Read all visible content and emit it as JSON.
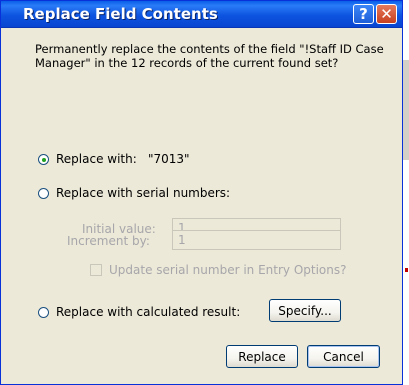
{
  "dialog": {
    "title": "Replace Field Contents",
    "help_glyph": "?",
    "close_glyph": "✕",
    "description": "Permanently replace the contents of the field \"!Staff ID Case Manager\" in the 12 records of the current found set?",
    "option_replace_with": {
      "label": "Replace with:",
      "value": "\"7013\"",
      "selected": true
    },
    "option_serial": {
      "label": "Replace with serial numbers:",
      "selected": false,
      "initial_value_label": "Initial value:",
      "initial_value": "1",
      "increment_label": "Increment by:",
      "increment_value": "1",
      "update_entry_options_label": "Update serial number in Entry Options?",
      "update_entry_options_checked": false
    },
    "option_calculated": {
      "label": "Replace with calculated result:",
      "selected": false,
      "specify_button": "Specify..."
    },
    "replace_button": "Replace",
    "cancel_button": "Cancel"
  },
  "colors": {
    "titlebar": "#0a5fe8",
    "dialog_bg": "#ece9d8",
    "disabled_text": "#a7a6aa",
    "radio_dot": "#21a121"
  },
  "icons": {
    "help": "question-mark-icon",
    "close": "close-x-icon"
  }
}
